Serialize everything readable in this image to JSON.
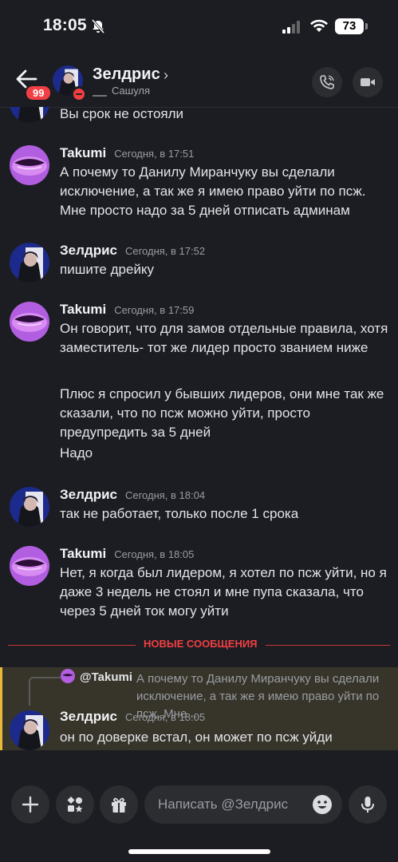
{
  "status": {
    "time": "18:05",
    "battery": "73"
  },
  "header": {
    "name": "Зелдрис",
    "subtitle": "Сашуля",
    "unread_badge": "99"
  },
  "messages": [
    {
      "author": "",
      "time": "",
      "lines": [
        "Вы срок не остояли"
      ]
    },
    {
      "author": "Takumi",
      "time": "Сегодня, в 17:51",
      "lines": [
        "А почему то Данилу Миранчуку вы сделали исключение, а так же я имею право уйти по псж. Мне просто надо за 5 дней отписать админам"
      ]
    },
    {
      "author": "Зелдрис",
      "time": "Сегодня, в 17:52",
      "lines": [
        "пишите дрейку"
      ]
    },
    {
      "author": "Takumi",
      "time": "Сегодня, в 17:59",
      "lines": [
        "Он говорит, что для замов отдельные правила, хотя заместитель- тот же лидер просто званием ниже",
        "Плюс я спросил у бывших лидеров, они мне так же сказали, что по псж можно уйти, просто предупредить за 5 дней",
        "Надо"
      ]
    },
    {
      "author": "Зелдрис",
      "time": "Сегодня, в 18:04",
      "lines": [
        "так не работает, только после 1 срока"
      ]
    },
    {
      "author": "Takumi",
      "time": "Сегодня, в 18:05",
      "lines": [
        "Нет, я когда был лидером, я хотел по псж уйти, но я даже 3 недель не стоял и мне пупа сказала, что через 5 дней ток могу уйти"
      ]
    }
  ],
  "new_messages_label": "НОВЫЕ СООБЩЕНИЯ",
  "reply": {
    "quoted_author": "@Takumi",
    "quoted_text": "А почему то Данилу Миранчуку вы сделали исключение, а так же я имею право уйти по псж. Мне ...",
    "author": "Зелдрис",
    "time": "Сегодня, в 18:05",
    "text": "он по доверке встал, он может по псж уйди"
  },
  "composer": {
    "placeholder": "Написать @Зелдрис"
  },
  "colors": {
    "background": "#1c1d22",
    "accent_red": "#f23f43",
    "highlight": "#37352a",
    "highlight_bar": "#e8b93a"
  },
  "icons": [
    "bell-off-icon",
    "signal-icon",
    "wifi-icon",
    "back-arrow-icon",
    "phone-icon",
    "video-icon",
    "plus-icon",
    "apps-icon",
    "gift-icon",
    "emoji-icon",
    "mic-icon"
  ]
}
